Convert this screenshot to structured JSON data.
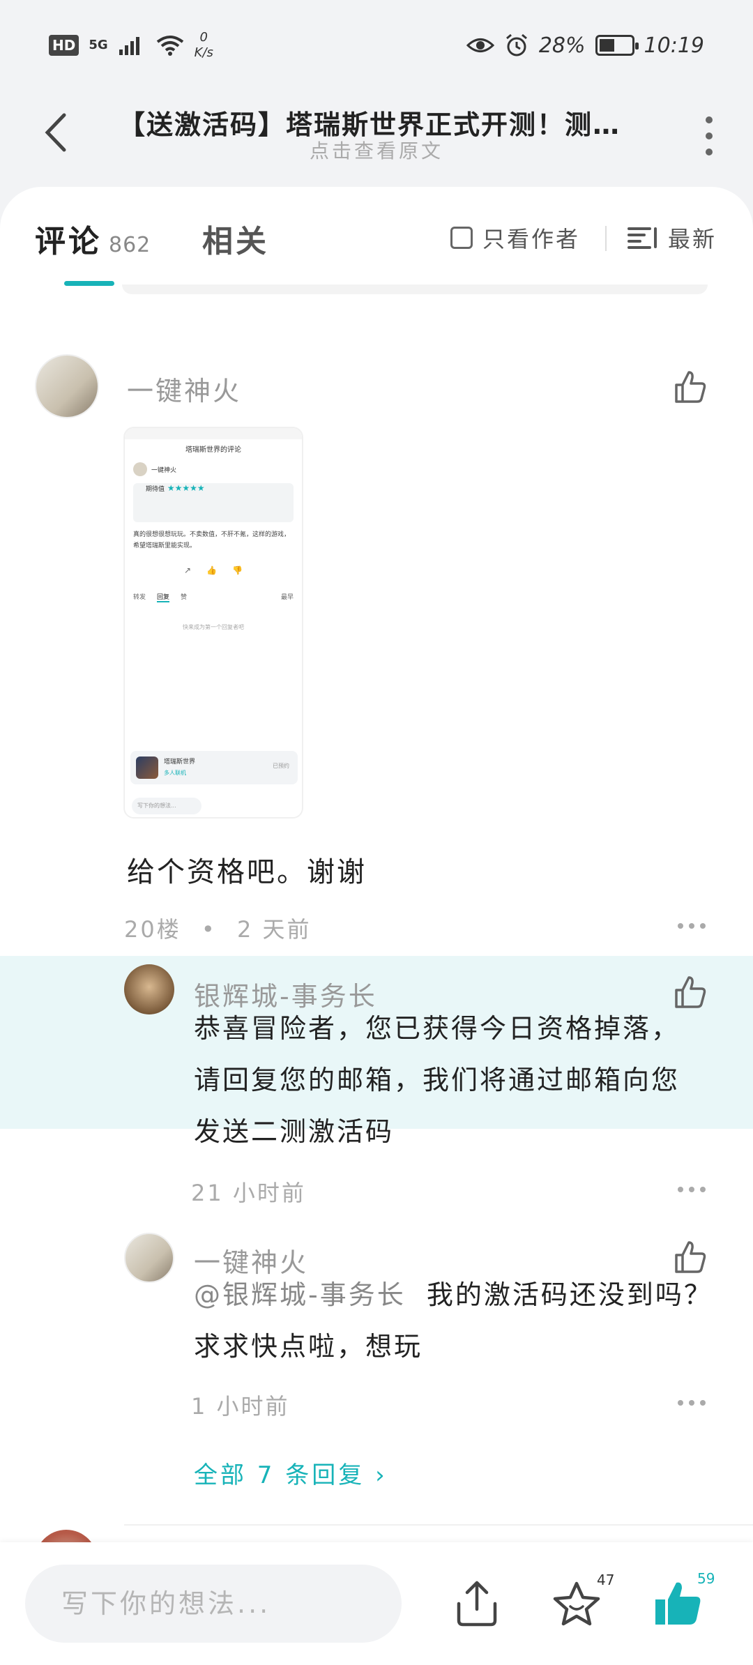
{
  "status_bar": {
    "network": "5G",
    "speed_value": "0",
    "speed_unit": "K/s",
    "battery": "28%",
    "time": "10:19"
  },
  "header": {
    "title": "【送激活码】塔瑞斯世界正式开测！测…",
    "subtitle": "点击查看原文"
  },
  "tabs": {
    "comments_label": "评论",
    "comments_count": "862",
    "related_label": "相关",
    "author_only_label": "只看作者",
    "sort_label": "最新"
  },
  "comment": {
    "username": "一键神火",
    "text": "给个资格吧。谢谢",
    "floor": "20楼",
    "time": "2 天前",
    "screenshot": {
      "title": "塔瑞斯世界的评论",
      "user": "一键神火",
      "rating_label": "期待值",
      "rating_stars": "★★★★★",
      "body": "真的很想很想玩玩。不卖数值，不肝不氪，这样的游戏，希望塔瑞斯里能实现。",
      "tab_forward": "转发",
      "tab_reply": "回复",
      "tab_like": "赞",
      "tab_sort": "最早",
      "empty_hint": "快来成为第一个回复者吧",
      "app_name": "塔瑞斯世界",
      "app_tag": "多人联机",
      "app_status": "已预约",
      "input_placeholder": "写下你的想法..."
    }
  },
  "replies": [
    {
      "username": "银辉城-事务长",
      "text_line1": "恭喜冒险者，您已获得今日资格掉落，",
      "text_line2": "请回复您的邮箱，我们将通过邮箱向您",
      "text_line3": "发送二测激活码",
      "time": "21 小时前"
    },
    {
      "username": "一键神火",
      "mention": "@银辉城-事务长",
      "text_line1": "我的激活码还没到吗？",
      "text_line2": "求求快点啦，想玩",
      "time": "1 小时前"
    }
  ],
  "all_replies_label": "全部 7 条回复",
  "bottom_bar": {
    "input_placeholder": "写下你的想法...",
    "favorite_count": "47",
    "like_count": "59"
  },
  "colors": {
    "accent": "#17b3b8",
    "reply_highlight": "#e9f7f8"
  }
}
